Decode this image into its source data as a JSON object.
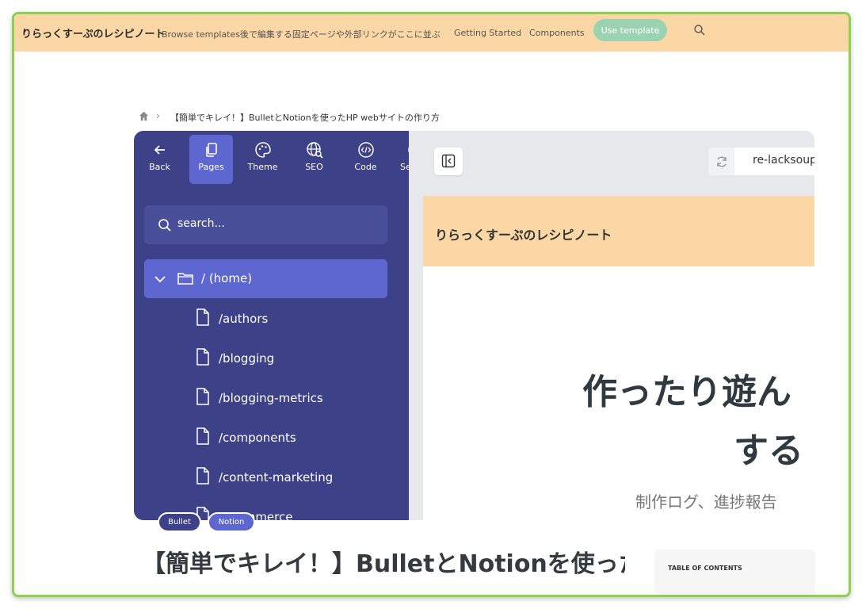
{
  "nav": {
    "brand": "りらっくすーぷのレシピノート",
    "browse": "Browse templates後で編集する固定ページや外部リンクがここに並ぶ",
    "getting_started": "Getting Started",
    "components": "Components",
    "use_template": "Use template",
    "search_icon": "search-icon"
  },
  "breadcrumb": {
    "current": "【簡単でキレイ！】BulletとNotionを使ったHP webサイトの作り方"
  },
  "editor": {
    "toolbar": [
      {
        "label": "Back",
        "icon": "arrow-left-icon"
      },
      {
        "label": "Pages",
        "icon": "pages-icon",
        "active": true
      },
      {
        "label": "Theme",
        "icon": "palette-icon"
      },
      {
        "label": "SEO",
        "icon": "globe-search-icon"
      },
      {
        "label": "Code",
        "icon": "code-icon"
      },
      {
        "label": "Se",
        "icon": "settings-icon"
      }
    ],
    "search_placeholder": "search...",
    "home": "/ (home)",
    "pages": [
      "/authors",
      "/blogging",
      "/blogging-metrics",
      "/components",
      "/content-marketing",
      "/ecommerce"
    ],
    "url": "re-lacksoup",
    "preview": {
      "brand": "りらっくすーぷのレシピノート",
      "hero_line1": "作ったり遊ん",
      "hero_line2": "する",
      "hero_sub": "制作ログ、進捗報告"
    }
  },
  "tags": [
    "Bullet",
    "Notion"
  ],
  "article": {
    "title": "【簡単でキレイ！】BulletとNotionを使ったHP webサイトの作り方"
  },
  "toc": {
    "title": "TABLE OF CONTENTS"
  },
  "colors": {
    "accent_border": "#8fd14f",
    "header_bg": "#fad7a4",
    "sidebar_bg": "#3d4187",
    "active_bg": "#5d67cf",
    "use_template_bg": "#9bd3b0"
  }
}
